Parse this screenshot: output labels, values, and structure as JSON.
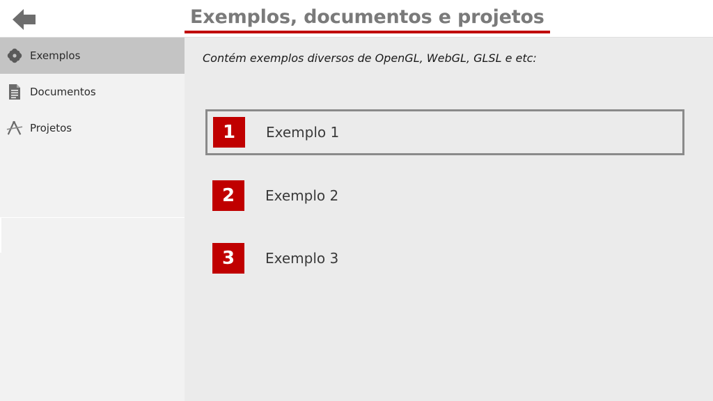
{
  "header": {
    "title": "Exemplos, documentos e projetos",
    "accent_color": "#c00000",
    "back_icon": "arrow-left-icon"
  },
  "sidebar": {
    "items": [
      {
        "label": "Exemplos",
        "icon": "flower-icon",
        "active": true
      },
      {
        "label": "Documentos",
        "icon": "document-icon",
        "active": false
      },
      {
        "label": "Projetos",
        "icon": "compass-tools-icon",
        "active": false
      }
    ]
  },
  "main": {
    "description": "Contém exemplos diversos de OpenGL, WebGL, GLSL e etc:",
    "items": [
      {
        "number": "1",
        "label": "Exemplo 1",
        "selected": true
      },
      {
        "number": "2",
        "label": "Exemplo 2",
        "selected": false
      },
      {
        "number": "3",
        "label": "Exemplo 3",
        "selected": false
      }
    ]
  }
}
